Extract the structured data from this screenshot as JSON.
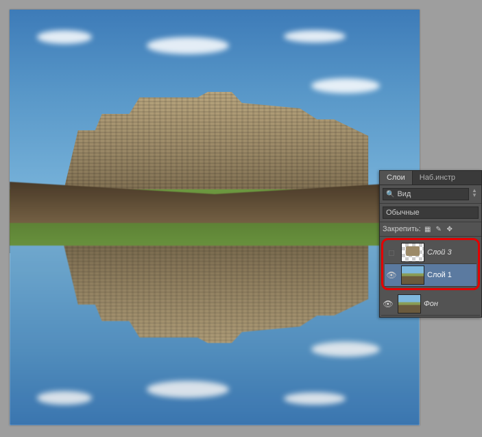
{
  "panel": {
    "tabs": {
      "layers": "Слои",
      "presets": "Наб.инстр"
    },
    "filter": {
      "placeholder": "Вид"
    },
    "blend": {
      "normal": "Обычные"
    },
    "lock": {
      "label": "Закрепить:"
    },
    "layers": [
      {
        "name": "Слой 3",
        "visible": false,
        "selected": false,
        "thumb": "checker"
      },
      {
        "name": "Слой 1",
        "visible": true,
        "selected": true,
        "thumb": "castle"
      },
      {
        "name": "Фон",
        "visible": true,
        "selected": false,
        "thumb": "castle"
      }
    ]
  }
}
